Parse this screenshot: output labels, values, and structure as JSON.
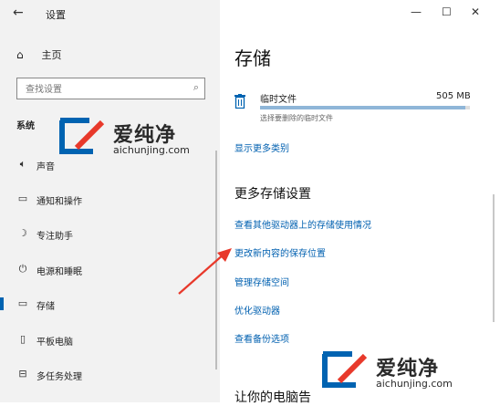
{
  "window": {
    "title": "设置",
    "back_icon": "←",
    "minimize": "—",
    "maximize": "☐",
    "close": "✕"
  },
  "sidebar": {
    "home_label": "主页",
    "search_placeholder": "查找设置",
    "section": "系统",
    "items": [
      {
        "label": "声音",
        "icon": "speaker-icon"
      },
      {
        "label": "通知和操作",
        "icon": "notification-icon"
      },
      {
        "label": "专注助手",
        "icon": "moon-icon"
      },
      {
        "label": "电源和睡眠",
        "icon": "power-icon"
      },
      {
        "label": "存储",
        "icon": "storage-icon",
        "active": true
      },
      {
        "label": "平板电脑",
        "icon": "tablet-icon"
      },
      {
        "label": "多任务处理",
        "icon": "multitask-icon"
      }
    ]
  },
  "main": {
    "title": "存储",
    "temp": {
      "name": "临时文件",
      "size": "505 MB",
      "hint": "选择要删除的临时文件",
      "fill_fraction": 0.98
    },
    "show_more": "显示更多类别",
    "more_title": "更多存储设置",
    "links": [
      "查看其他驱动器上的存储使用情况",
      "更改新内容的保存位置",
      "管理存储空间",
      "优化驱动器",
      "查看备份选项"
    ],
    "bottom_title": "让你的电脑告"
  },
  "watermark": {
    "text": "爱纯净",
    "url": "aichunjing.com"
  },
  "colors": {
    "accent": "#0063b1",
    "link": "#0060b0",
    "arrow": "#e8392b"
  }
}
